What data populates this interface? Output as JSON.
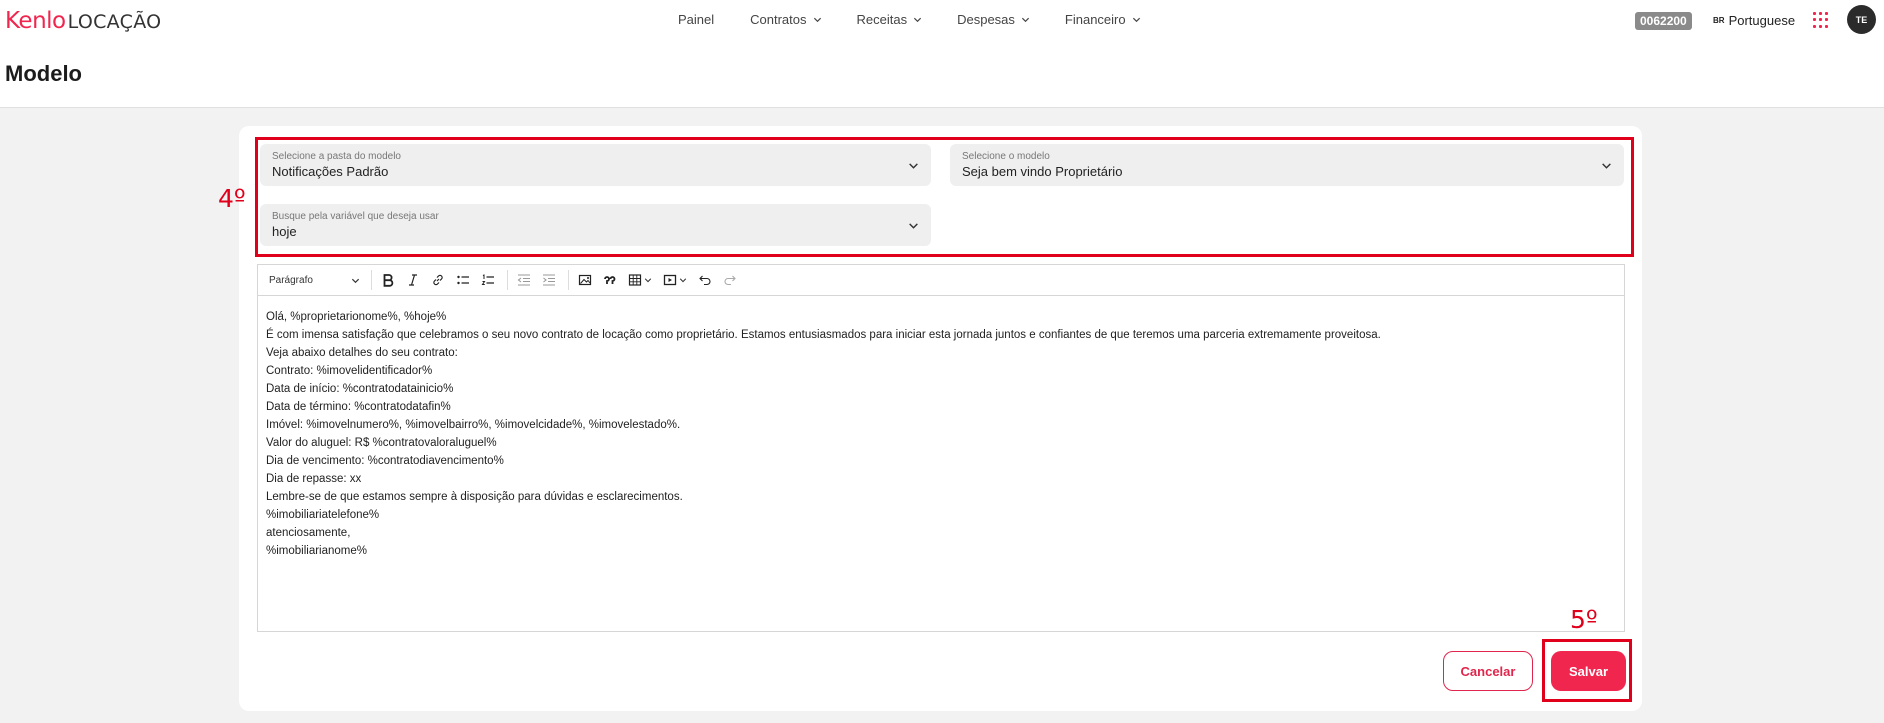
{
  "header": {
    "logo_brand": "Kenlo",
    "logo_product": "LOCAÇÃO",
    "nav": [
      {
        "label": "Painel",
        "dropdown": false
      },
      {
        "label": "Contratos",
        "dropdown": true
      },
      {
        "label": "Receitas",
        "dropdown": true
      },
      {
        "label": "Despesas",
        "dropdown": true
      },
      {
        "label": "Financeiro",
        "dropdown": true
      }
    ],
    "account_code": "0062200",
    "language_flag": "BR",
    "language": "Portuguese",
    "avatar_initials": "TE"
  },
  "page": {
    "title": "Modelo"
  },
  "form": {
    "folder": {
      "label": "Selecione a pasta do modelo",
      "value": "Notificações Padrão"
    },
    "model": {
      "label": "Selecione o modelo",
      "value": "Seja bem vindo Proprietário"
    },
    "variable": {
      "label": "Busque pela variável que deseja usar",
      "value": "hoje"
    }
  },
  "editor": {
    "format_select": "Parágrafo",
    "lines": [
      "Olá, %proprietarionome%, %hoje%",
      "É com imensa satisfação que celebramos o seu novo contrato de locação como proprietário. Estamos entusiasmados para iniciar esta jornada juntos e confiantes de que teremos uma parceria extremamente proveitosa.",
      "Veja abaixo detalhes do seu contrato:",
      "Contrato: %imovelidentificador%",
      "Data de início: %contratodatainicio%",
      "Data de término: %contratodatafin%",
      "Imóvel: %imovelnumero%, %imovelbairro%, %imovelcidade%, %imovelestado%.",
      "Valor do aluguel: R$ %contratovaloraluguel%",
      "Dia de vencimento: %contratodiavencimento%",
      "Dia de repasse: xx",
      "Lembre-se de que estamos sempre à disposição para dúvidas e esclarecimentos.",
      "%imobiliariatelefone%",
      "atenciosamente,",
      "%imobiliarianome%"
    ]
  },
  "actions": {
    "cancel": "Cancelar",
    "save": "Salvar"
  },
  "annotations": {
    "step4": "4º",
    "step5": "5º"
  },
  "colors": {
    "brand": "#f0264e",
    "annotation": "#e0001b"
  }
}
